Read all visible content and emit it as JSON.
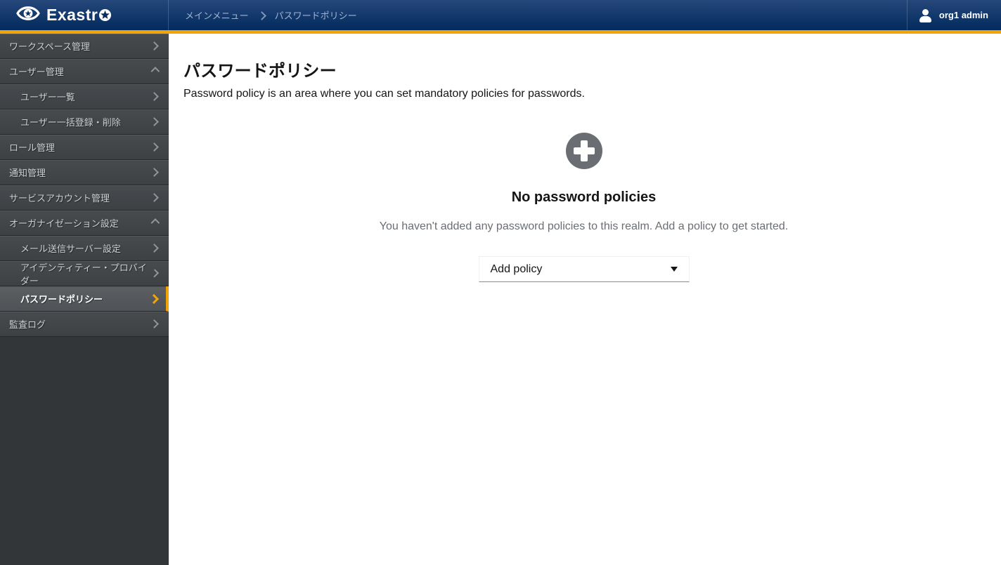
{
  "header": {
    "logo_text": "Exastro",
    "breadcrumb": [
      "メインメニュー",
      "パスワードポリシー"
    ],
    "user": "org1 admin"
  },
  "sidebar": {
    "items": [
      {
        "id": "workspace-management",
        "label": "ワークスペース管理",
        "level": 0,
        "chevron": "right",
        "selected": false
      },
      {
        "id": "user-management",
        "label": "ユーザー管理",
        "level": 0,
        "chevron": "up",
        "selected": false
      },
      {
        "id": "user-list",
        "label": "ユーザー一覧",
        "level": 1,
        "chevron": "right",
        "selected": false
      },
      {
        "id": "user-bulk-register-delete",
        "label": "ユーザー一括登録・削除",
        "level": 1,
        "chevron": "right",
        "selected": false
      },
      {
        "id": "role-management",
        "label": "ロール管理",
        "level": 0,
        "chevron": "right",
        "selected": false
      },
      {
        "id": "notification-management",
        "label": "通知管理",
        "level": 0,
        "chevron": "right",
        "selected": false
      },
      {
        "id": "service-account-management",
        "label": "サービスアカウント管理",
        "level": 0,
        "chevron": "right",
        "selected": false
      },
      {
        "id": "organization-settings",
        "label": "オーガナイゼーション設定",
        "level": 0,
        "chevron": "up",
        "selected": false
      },
      {
        "id": "mail-server-settings",
        "label": "メール送信サーバー設定",
        "level": 1,
        "chevron": "right",
        "selected": false
      },
      {
        "id": "identity-provider",
        "label": "アイデンティティー・プロバイダー",
        "level": 1,
        "chevron": "right",
        "selected": false
      },
      {
        "id": "password-policy",
        "label": "パスワードポリシー",
        "level": 1,
        "chevron": "right",
        "selected": true
      },
      {
        "id": "audit-log",
        "label": "監査ログ",
        "level": 0,
        "chevron": "right",
        "selected": false
      }
    ]
  },
  "main": {
    "title": "パスワードポリシー",
    "description": "Password policy is an area where you can set mandatory policies for passwords.",
    "empty_state": {
      "heading": "No password policies",
      "body": "You haven't added any password policies to this realm. Add a policy to get started.",
      "add_button_label": "Add policy"
    }
  },
  "icons": {
    "logo": "exastro-eye-icon",
    "user": "user-icon",
    "plus": "plus-circle-icon",
    "caret": "caret-down-icon"
  },
  "colors": {
    "accent_orange": "#f0a40a",
    "header_gradient_top": "#26477a",
    "header_gradient_bottom": "#022b5e",
    "sidebar_row": "#3f4346",
    "sidebar_selected": "#55595c",
    "breadcrumb_text": "#9db3d3",
    "muted_text": "#6a6e73",
    "dark_text": "#151515",
    "plus_circle": "#6a6e73"
  }
}
